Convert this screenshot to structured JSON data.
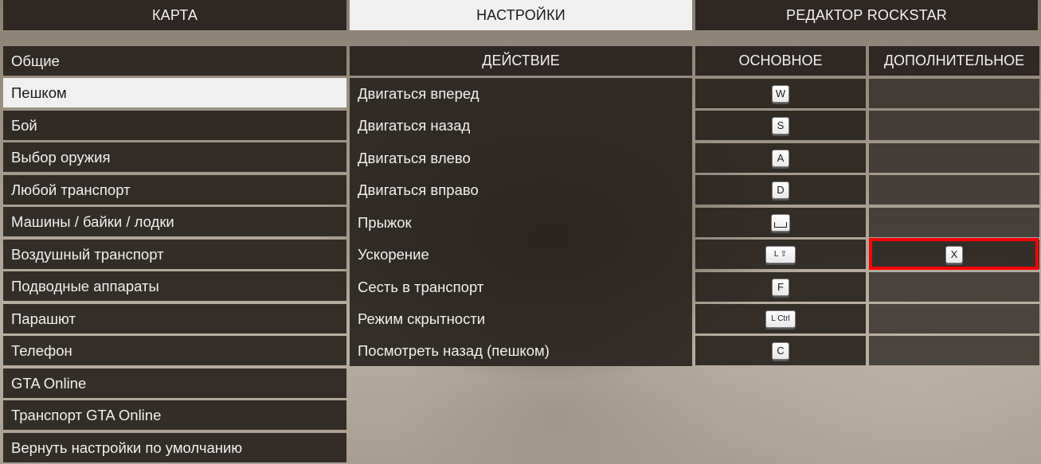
{
  "tabs": [
    {
      "label": "КАРТА",
      "active": false
    },
    {
      "label": "НАСТРОЙКИ",
      "active": true
    },
    {
      "label": "РЕДАКТОР ROCKSTAR",
      "active": false
    }
  ],
  "sidebar": {
    "items": [
      {
        "label": "Общие",
        "active": false
      },
      {
        "label": "Пешком",
        "active": true
      },
      {
        "label": "Бой",
        "active": false
      },
      {
        "label": "Выбор оружия",
        "active": false
      },
      {
        "label": "Любой транспорт",
        "active": false
      },
      {
        "label": "Машины / байки / лодки",
        "active": false
      },
      {
        "label": "Воздушный транспорт",
        "active": false
      },
      {
        "label": "Подводные аппараты",
        "active": false
      },
      {
        "label": "Парашют",
        "active": false
      },
      {
        "label": "Телефон",
        "active": false
      },
      {
        "label": "GTA Online",
        "active": false
      },
      {
        "label": "Транспорт GTA Online",
        "active": false
      },
      {
        "label": "Вернуть настройки по умолчанию",
        "active": false
      }
    ]
  },
  "table": {
    "headers": {
      "action": "ДЕЙСТВИЕ",
      "primary": "ОСНОВНОЕ",
      "secondary": "ДОПОЛНИТЕЛЬНОЕ"
    },
    "rows": [
      {
        "action": "Двигаться вперед",
        "primary": "W",
        "secondary": ""
      },
      {
        "action": "Двигаться назад",
        "primary": "S",
        "secondary": ""
      },
      {
        "action": "Двигаться влево",
        "primary": "A",
        "secondary": ""
      },
      {
        "action": "Двигаться вправо",
        "primary": "D",
        "secondary": ""
      },
      {
        "action": "Прыжок",
        "primary": "space",
        "secondary": ""
      },
      {
        "action": "Ускорение",
        "primary": "L ⇧",
        "secondary": "X"
      },
      {
        "action": "Сесть в транспорт",
        "primary": "F",
        "secondary": ""
      },
      {
        "action": "Режим скрытности",
        "primary": "L Ctrl",
        "secondary": ""
      },
      {
        "action": "Посмотреть назад (пешком)",
        "primary": "C",
        "secondary": ""
      }
    ]
  },
  "colors": {
    "highlight": "#ff0000",
    "panel": "#26201c",
    "active_bg": "#f0f0f0"
  }
}
